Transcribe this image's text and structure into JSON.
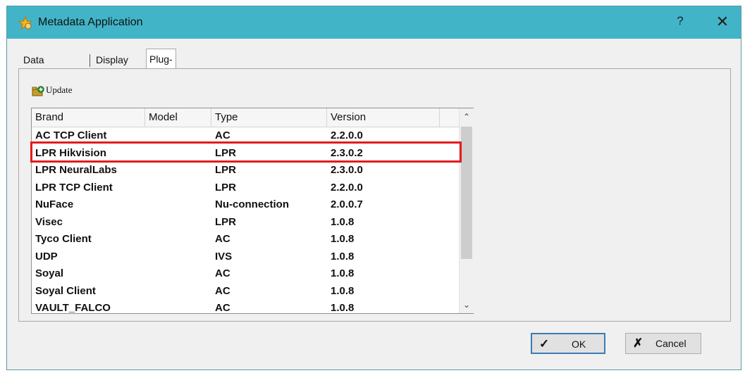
{
  "window": {
    "title": "Metadata Application",
    "help_label": "?",
    "close_label": "✕"
  },
  "tabs": [
    {
      "label": "Data Source"
    },
    {
      "label": "Display"
    },
    {
      "label": "Plug-in"
    }
  ],
  "toolbar": {
    "update_label": "Update"
  },
  "table": {
    "columns": [
      "Brand",
      "Model",
      "Type",
      "Version"
    ],
    "rows": [
      {
        "brand": "AC TCP Client",
        "model": "",
        "type": "AC",
        "version": "2.2.0.0"
      },
      {
        "brand": "LPR Hikvision",
        "model": "",
        "type": "LPR",
        "version": "2.3.0.2"
      },
      {
        "brand": "LPR NeuralLabs",
        "model": "",
        "type": "LPR",
        "version": "2.3.0.0"
      },
      {
        "brand": "LPR TCP Client",
        "model": "",
        "type": "LPR",
        "version": "2.2.0.0"
      },
      {
        "brand": "NuFace",
        "model": "",
        "type": "Nu-connection",
        "version": "2.0.0.7"
      },
      {
        "brand": "Visec",
        "model": "",
        "type": "LPR",
        "version": "1.0.8"
      },
      {
        "brand": "Tyco Client",
        "model": "",
        "type": "AC",
        "version": "1.0.8"
      },
      {
        "brand": "UDP",
        "model": "",
        "type": "IVS",
        "version": "1.0.8"
      },
      {
        "brand": "Soyal",
        "model": "",
        "type": "AC",
        "version": "1.0.8"
      },
      {
        "brand": "Soyal Client",
        "model": "",
        "type": "AC",
        "version": "1.0.8"
      },
      {
        "brand": "VAULT_FALCO",
        "model": "",
        "type": "AC",
        "version": "1.0.8"
      }
    ]
  },
  "buttons": {
    "ok_label": "OK",
    "cancel_label": "Cancel"
  },
  "colors": {
    "titlebar": "#42b4c8",
    "highlight": "#e41b1b"
  }
}
